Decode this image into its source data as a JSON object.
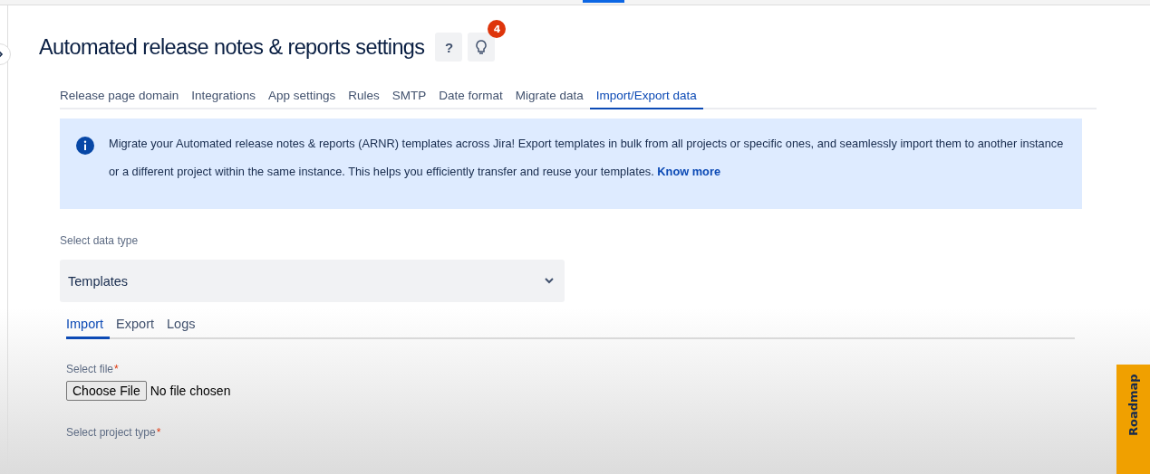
{
  "page": {
    "title": "Automated release notes & reports settings",
    "help_label": "?",
    "notification_count": "4"
  },
  "tabs": [
    {
      "label": "Release page domain",
      "selected": false
    },
    {
      "label": "Integrations",
      "selected": false
    },
    {
      "label": "App settings",
      "selected": false
    },
    {
      "label": "Rules",
      "selected": false
    },
    {
      "label": "SMTP",
      "selected": false
    },
    {
      "label": "Date format",
      "selected": false
    },
    {
      "label": "Migrate data",
      "selected": false
    },
    {
      "label": "Import/Export data",
      "selected": true
    }
  ],
  "info": {
    "text": "Migrate your Automated release notes & reports (ARNR) templates across Jira! Export templates in bulk from all projects or specific ones, and seamlessly import them to another instance or a different project within the same instance. This helps you efficiently transfer and reuse your templates.",
    "link": "Know more"
  },
  "data_type": {
    "label": "Select data type",
    "value": "Templates"
  },
  "subtabs": [
    {
      "label": "Import",
      "selected": true
    },
    {
      "label": "Export",
      "selected": false
    },
    {
      "label": "Logs",
      "selected": false
    }
  ],
  "file_field": {
    "label": "Select file",
    "required_mark": "*",
    "button": "Choose File",
    "status": "No file chosen"
  },
  "project_type": {
    "label": "Select project type",
    "required_mark": "*"
  },
  "roadmap_tab": "Roadmap"
}
